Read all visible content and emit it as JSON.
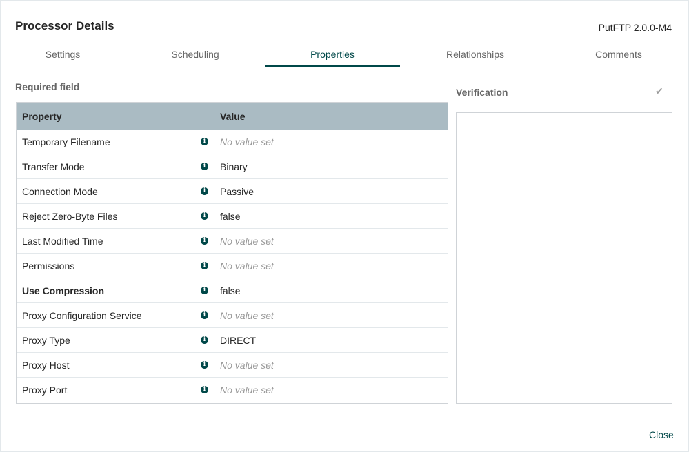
{
  "dialog": {
    "title": "Processor Details",
    "component_version": "PutFTP 2.0.0-M4",
    "close_label": "Close"
  },
  "tabs": [
    {
      "label": "Settings"
    },
    {
      "label": "Scheduling"
    },
    {
      "label": "Properties",
      "active": true
    },
    {
      "label": "Relationships"
    },
    {
      "label": "Comments"
    }
  ],
  "properties": {
    "required_label": "Required field",
    "header": {
      "property": "Property",
      "value": "Value"
    },
    "rows": [
      {
        "name": "Temporary Filename",
        "value": "No value set",
        "unset": true,
        "required": false
      },
      {
        "name": "Transfer Mode",
        "value": "Binary",
        "unset": false,
        "required": false
      },
      {
        "name": "Connection Mode",
        "value": "Passive",
        "unset": false,
        "required": false
      },
      {
        "name": "Reject Zero-Byte Files",
        "value": "false",
        "unset": false,
        "required": false
      },
      {
        "name": "Last Modified Time",
        "value": "No value set",
        "unset": true,
        "required": false
      },
      {
        "name": "Permissions",
        "value": "No value set",
        "unset": true,
        "required": false
      },
      {
        "name": "Use Compression",
        "value": "false",
        "unset": false,
        "required": true
      },
      {
        "name": "Proxy Configuration Service",
        "value": "No value set",
        "unset": true,
        "required": false
      },
      {
        "name": "Proxy Type",
        "value": "DIRECT",
        "unset": false,
        "required": false
      },
      {
        "name": "Proxy Host",
        "value": "No value set",
        "unset": true,
        "required": false
      },
      {
        "name": "Proxy Port",
        "value": "No value set",
        "unset": true,
        "required": false
      }
    ]
  },
  "verification": {
    "title": "Verification",
    "icon": "check-icon"
  },
  "colors": {
    "accent": "#004849",
    "header_bg": "#aabbc3",
    "muted": "#999999"
  }
}
